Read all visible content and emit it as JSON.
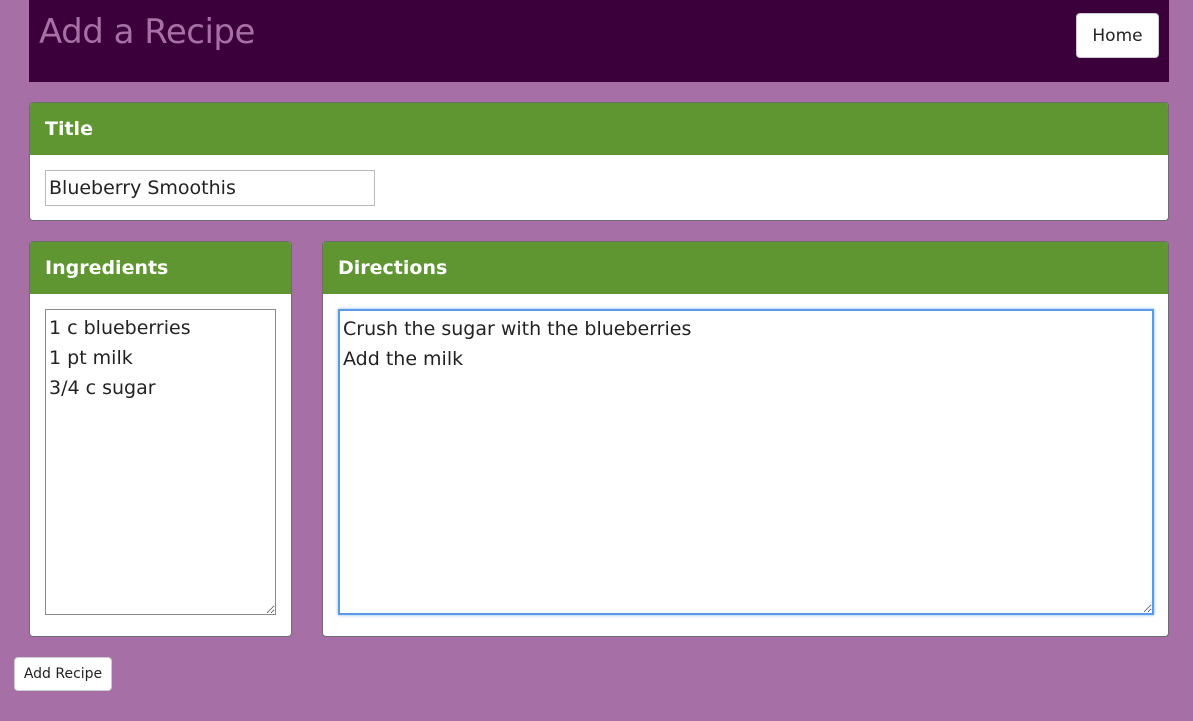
{
  "header": {
    "title": "Add a Recipe",
    "home_label": "Home"
  },
  "title_panel": {
    "heading": "Title",
    "value": "Blueberry Smoothis"
  },
  "ingredients_panel": {
    "heading": "Ingredients",
    "value": "1 c blueberries\n1 pt milk\n3/4 c sugar"
  },
  "directions_panel": {
    "heading": "Directions",
    "value": "Crush the sugar with the blueberries\nAdd the milk"
  },
  "actions": {
    "add_recipe_label": "Add Recipe"
  },
  "colors": {
    "background": "#a66fa6",
    "header_bg": "#3b003b",
    "panel_heading": "#5f9632",
    "focus_ring": "#5b9be6"
  }
}
